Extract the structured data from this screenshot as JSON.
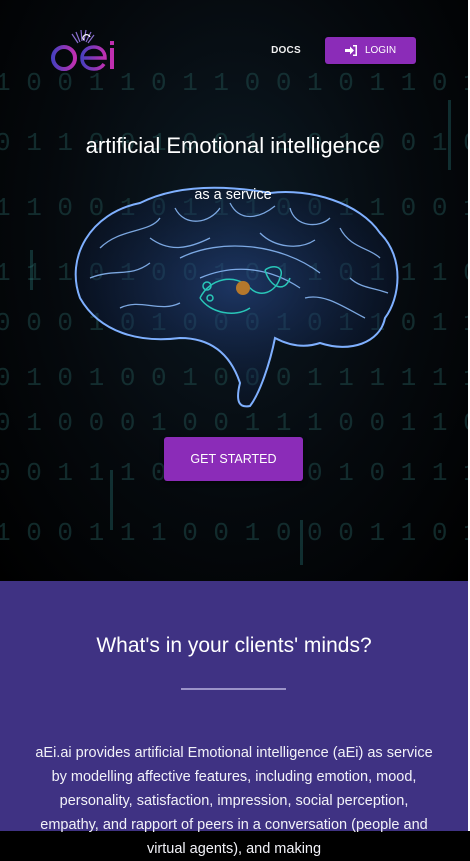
{
  "header": {
    "logo_icon": "aei-logo",
    "docs_label": "DOCS",
    "login_label": "LOGIN",
    "login_icon": "sign-in-icon"
  },
  "hero": {
    "headline": "artificial Emotional intelligence",
    "subline": "as a service",
    "image": "brain-illustration",
    "cta_label": "GET STARTED"
  },
  "about": {
    "heading": "What's in your clients' minds?",
    "paragraph": "aEi.ai provides artificial Emotional intelligence (aEi) as service by modelling affective features, including emotion, mood, personality, satisfaction, impression, social perception, empathy, and rapport of peers in a conversation (people and virtual agents), and making"
  },
  "colors": {
    "accent": "#8b2cb8",
    "section_bg": "#3f3283",
    "hero_bg": "#000000"
  }
}
